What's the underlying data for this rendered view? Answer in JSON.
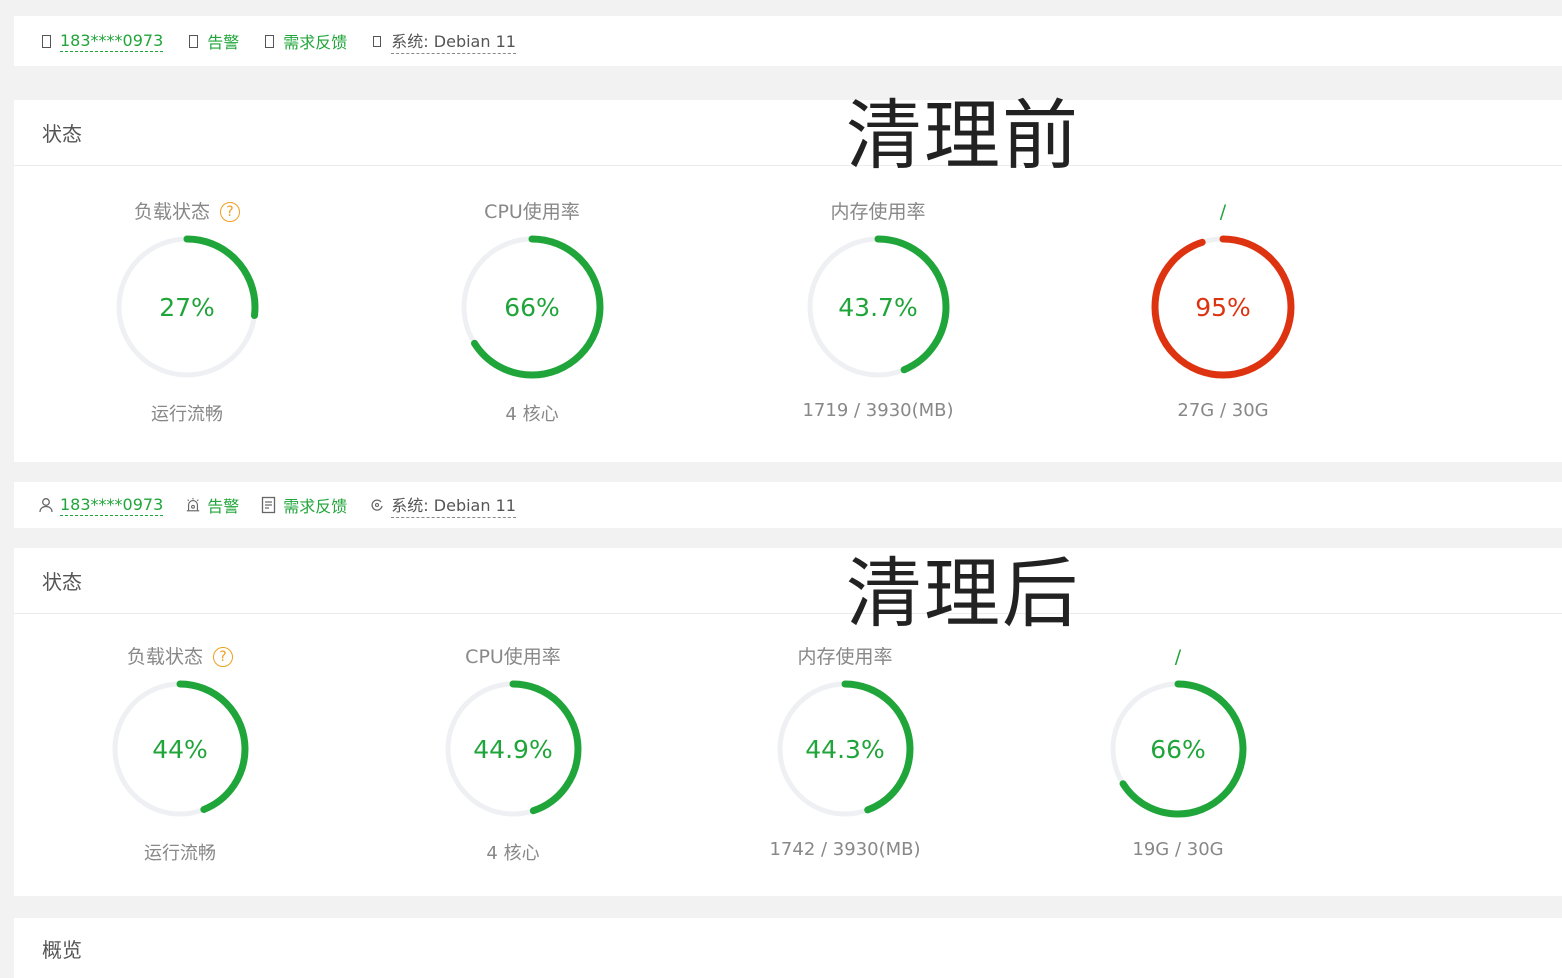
{
  "before": {
    "topbar": {
      "user": "183****0973",
      "alert": "告警",
      "feedback": "需求反馈",
      "system": "系统:  Debian 11"
    },
    "label": "清理前",
    "status_title": "状态",
    "gauges": [
      {
        "title": "负载状态",
        "help": "?",
        "value": 27,
        "display": "27%",
        "sub": "运行流畅",
        "color": "#20a53a"
      },
      {
        "title": "CPU使用率",
        "value": 66,
        "display": "66%",
        "sub": "4 核心",
        "color": "#20a53a"
      },
      {
        "title": "内存使用率",
        "value": 43.7,
        "display": "43.7%",
        "sub": "1719 / 3930(MB)",
        "color": "#20a53a"
      },
      {
        "title": "/",
        "value": 95,
        "display": "95%",
        "sub": "27G / 30G",
        "color": "#dd3311"
      }
    ]
  },
  "after": {
    "topbar": {
      "user": "183****0973",
      "alert": "告警",
      "feedback": "需求反馈",
      "system": "系统:  Debian 11"
    },
    "label": "清理后",
    "status_title": "状态",
    "gauges": [
      {
        "title": "负载状态",
        "help": "?",
        "value": 44,
        "display": "44%",
        "sub": "运行流畅",
        "color": "#20a53a"
      },
      {
        "title": "CPU使用率",
        "value": 44.9,
        "display": "44.9%",
        "sub": "4 核心",
        "color": "#20a53a"
      },
      {
        "title": "内存使用率",
        "value": 44.3,
        "display": "44.3%",
        "sub": "1742 / 3930(MB)",
        "color": "#20a53a"
      },
      {
        "title": "/",
        "value": 66,
        "display": "66%",
        "sub": "19G / 30G",
        "color": "#20a53a"
      }
    ]
  },
  "summary_title": "概览",
  "icons": {
    "user": "user-icon",
    "alert": "alarm-icon",
    "feedback": "feedback-icon",
    "system": "system-icon"
  }
}
